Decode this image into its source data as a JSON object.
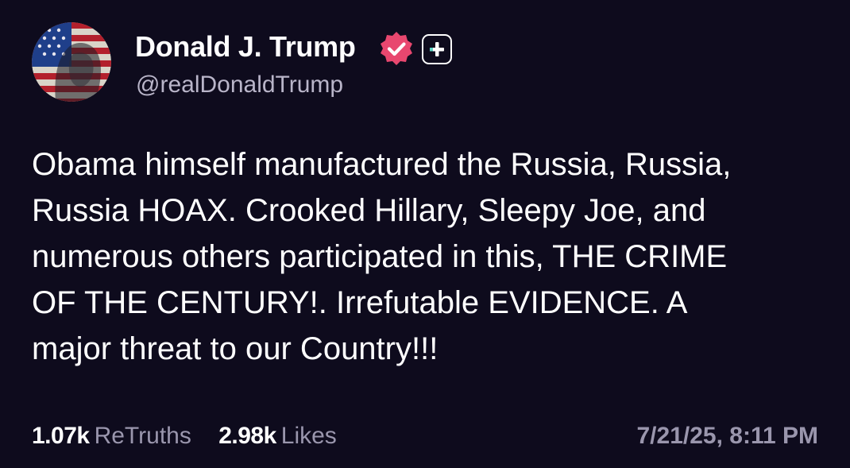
{
  "author": {
    "display_name": "Donald J. Trump",
    "handle": "@realDonaldTrump",
    "verified_icon": "verified-check-badge-icon",
    "verified_color": "#e8476f",
    "follow_icon": "plus-icon"
  },
  "post": {
    "lines": [
      "Obama himself manufactured the Russia, Russia,",
      "Russia HOAX. Crooked Hillary, Sleepy Joe, and",
      "numerous others participated in this, THE CRIME",
      "OF THE CENTURY!. Irrefutable EVIDENCE. A",
      "major threat to our Country!!!"
    ]
  },
  "stats": {
    "retruths_count": "1.07k",
    "retruths_label": "ReTruths",
    "likes_count": "2.98k",
    "likes_label": "Likes"
  },
  "timestamp": "7/21/25, 8:11 PM",
  "colors": {
    "background": "#0e0b1d",
    "text": "#ffffff",
    "muted": "#9a96ad"
  }
}
